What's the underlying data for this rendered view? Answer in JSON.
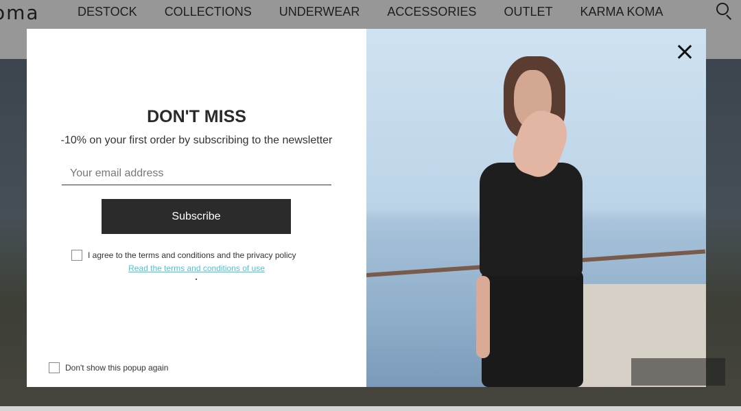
{
  "header": {
    "logo_text": "oma",
    "nav": [
      {
        "label": "DESTOCK"
      },
      {
        "label": "COLLECTIONS"
      },
      {
        "label": "UNDERWEAR"
      },
      {
        "label": "ACCESSORIES"
      },
      {
        "label": "OUTLET"
      },
      {
        "label": "KARMA KOMA"
      }
    ],
    "search_icon": "search-icon"
  },
  "popup": {
    "title": "DON'T MISS",
    "subtitle": "-10% on your first order by subscribing to the newsletter",
    "email": {
      "value": "",
      "placeholder": "Your email address"
    },
    "subscribe_label": "Subscribe",
    "terms_text": "I agree to the terms and conditions and the privacy policy",
    "terms_link": "Read the terms and conditions of use",
    "noshow_text": "Don't show this popup again",
    "close_icon": "close-icon"
  },
  "colors": {
    "accent_link": "#49c5d8",
    "button_bg": "#2b2b2b",
    "overlay": "rgba(0,0,0,0.35)"
  }
}
